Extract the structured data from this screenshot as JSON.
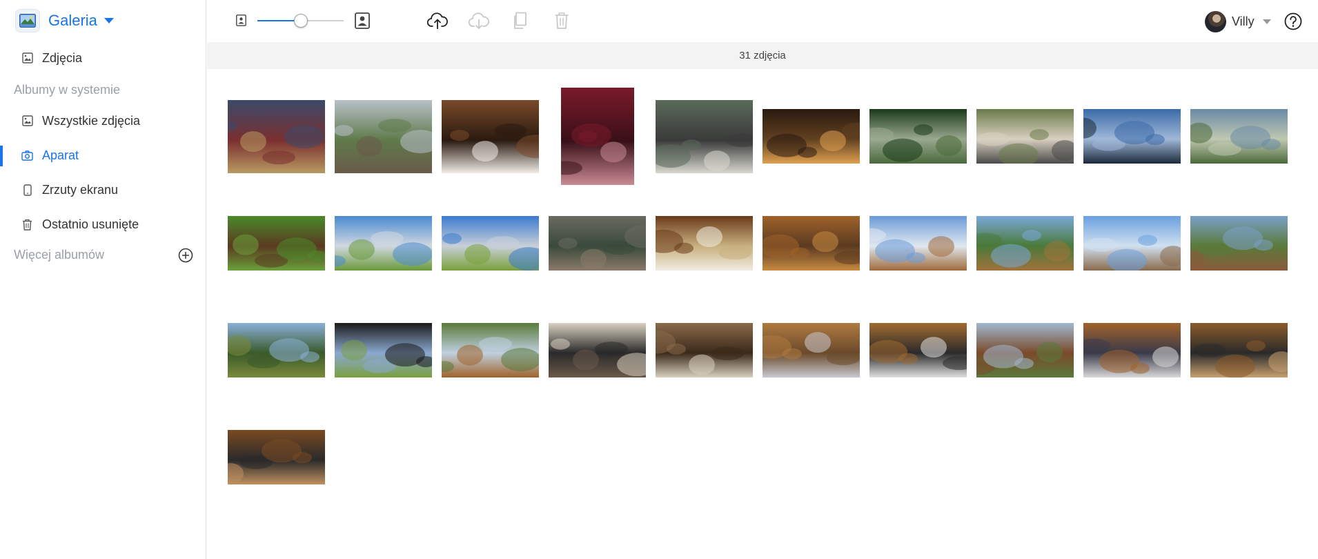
{
  "app": {
    "title": "Galeria"
  },
  "sidebar": {
    "photos_label": "Zdjęcia",
    "system_albums_label": "Albumy w systemie",
    "albums": [
      {
        "label": "Wszystkie zdjęcia",
        "icon": "image-icon",
        "active": false
      },
      {
        "label": "Aparat",
        "icon": "camera-icon",
        "active": true
      },
      {
        "label": "Zrzuty ekranu",
        "icon": "phone-icon",
        "active": false
      },
      {
        "label": "Ostatnio usunięte",
        "icon": "trash-icon",
        "active": false
      }
    ],
    "more_albums_label": "Więcej albumów"
  },
  "toolbar": {
    "zoom_level": 0.5,
    "icons": [
      "upload-icon",
      "download-icon",
      "copy-icon",
      "delete-icon"
    ],
    "disabled_icons": [
      "download-icon",
      "copy-icon",
      "delete-icon"
    ]
  },
  "user": {
    "name": "Villy"
  },
  "status": {
    "photo_count": "31 zdjęcia"
  },
  "colors": {
    "accent": "#1a73e8",
    "sidebar_text": "#333333",
    "muted": "#9aa0a6",
    "countbar_bg": "#f3f3f3"
  },
  "photos": [
    {
      "orientation": "landscape",
      "subject": "board games on shelf",
      "colors": [
        "#3a4a6a",
        "#b89a62",
        "#7a2f2f"
      ]
    },
    {
      "orientation": "landscape",
      "subject": "tree and apartment blocks",
      "colors": [
        "#b8c0c8",
        "#6a5a4a",
        "#5f7a4a"
      ]
    },
    {
      "orientation": "landscape",
      "subject": "dog close-up",
      "colors": [
        "#7a4a2a",
        "#f0ece6",
        "#2a1a10"
      ]
    },
    {
      "orientation": "portrait",
      "subject": "glasses of red drink",
      "colors": [
        "#7a1a2a",
        "#c98a94",
        "#3a1018"
      ]
    },
    {
      "orientation": "landscape",
      "subject": "bookshelf room",
      "colors": [
        "#5a6a5a",
        "#d8d8d0",
        "#3a3a3a"
      ]
    },
    {
      "orientation": "landscape-wide",
      "subject": "sunset over hills",
      "colors": [
        "#2a1a10",
        "#e0a050",
        "#604020"
      ]
    },
    {
      "orientation": "landscape-wide",
      "subject": "forest stream",
      "colors": [
        "#1a3a1a",
        "#4a6a3a",
        "#9aa890"
      ]
    },
    {
      "orientation": "landscape-wide",
      "subject": "sheep grazing",
      "colors": [
        "#6a7a4a",
        "#4a4a4a",
        "#d8d0c0"
      ]
    },
    {
      "orientation": "landscape-wide",
      "subject": "group jumping under sky",
      "colors": [
        "#3a6aa8",
        "#1a2a3a",
        "#a0b8d8"
      ]
    },
    {
      "orientation": "landscape-wide",
      "subject": "mountain valley panorama",
      "colors": [
        "#6a8aa8",
        "#4a6a3a",
        "#c0c8b0"
      ]
    },
    {
      "orientation": "landscape-wide",
      "subject": "grass with animal",
      "colors": [
        "#4a8a2a",
        "#6aa03a",
        "#5a3a20"
      ]
    },
    {
      "orientation": "landscape-wide",
      "subject": "ski lift meadow",
      "colors": [
        "#4a8ad0",
        "#6a9a3a",
        "#d0d8e0"
      ]
    },
    {
      "orientation": "landscape-wide",
      "subject": "ski lift meadow",
      "colors": [
        "#3a7ad0",
        "#7aa03a",
        "#c8d0d8"
      ]
    },
    {
      "orientation": "landscape-wide",
      "subject": "crowded street",
      "colors": [
        "#6a6a60",
        "#8a7a6a",
        "#3a4a3a"
      ]
    },
    {
      "orientation": "landscape-wide",
      "subject": "plate of dumplings",
      "colors": [
        "#6a3a1a",
        "#f0ece0",
        "#c8b080"
      ]
    },
    {
      "orientation": "landscape-wide",
      "subject": "wooden wall sign",
      "colors": [
        "#a0622a",
        "#c88a40",
        "#5a3a20"
      ]
    },
    {
      "orientation": "landscape-wide",
      "subject": "wooden house tilted",
      "colors": [
        "#6a9ad8",
        "#a06a3a",
        "#e0e8f0"
      ]
    },
    {
      "orientation": "landscape-wide",
      "subject": "wooden houses row",
      "colors": [
        "#7aa8d8",
        "#a0723a",
        "#4a7a3a"
      ]
    },
    {
      "orientation": "landscape-wide",
      "subject": "balcony from below",
      "colors": [
        "#6aa0e0",
        "#8a6a4a",
        "#d0e0f0"
      ]
    },
    {
      "orientation": "landscape-wide",
      "subject": "mountain chalet",
      "colors": [
        "#7aa0c8",
        "#8a5a3a",
        "#5a7a3a"
      ]
    },
    {
      "orientation": "landscape-wide",
      "subject": "field with trees",
      "colors": [
        "#8ab0d8",
        "#7a8a3a",
        "#3a5a2a"
      ]
    },
    {
      "orientation": "landscape-wide",
      "subject": "view through window",
      "colors": [
        "#1a1a1a",
        "#7aa040",
        "#8aa8d0"
      ]
    },
    {
      "orientation": "landscape-wide",
      "subject": "tilted garden view",
      "colors": [
        "#5a7a3a",
        "#a0622a",
        "#c0d0e0"
      ]
    },
    {
      "orientation": "landscape-wide",
      "subject": "kitchen interior",
      "colors": [
        "#d8d0c0",
        "#6a5a4a",
        "#2a2a2a"
      ]
    },
    {
      "orientation": "landscape-wide",
      "subject": "room doorway",
      "colors": [
        "#8a6a4a",
        "#d8d0c0",
        "#3a2a1a"
      ]
    },
    {
      "orientation": "landscape-wide",
      "subject": "bedroom with bed",
      "colors": [
        "#b07a40",
        "#c8c8d0",
        "#6a4a2a"
      ]
    },
    {
      "orientation": "landscape-wide",
      "subject": "bathroom tilted",
      "colors": [
        "#a06a30",
        "#e0e0e0",
        "#2a2a2a"
      ]
    },
    {
      "orientation": "landscape-wide",
      "subject": "chalets and mountains",
      "colors": [
        "#a0b8d0",
        "#5a7a3a",
        "#7a4a2a"
      ]
    },
    {
      "orientation": "landscape-wide",
      "subject": "wooden stairs interior",
      "colors": [
        "#a0622a",
        "#d8d8d8",
        "#3a3a4a"
      ]
    },
    {
      "orientation": "landscape-wide",
      "subject": "living room with balcony",
      "colors": [
        "#8a5a2a",
        "#c8a070",
        "#2a2a2a"
      ]
    },
    {
      "orientation": "landscape-wide",
      "subject": "living room with balcony",
      "colors": [
        "#7a4a22",
        "#c09060",
        "#2a2a2a"
      ]
    }
  ]
}
